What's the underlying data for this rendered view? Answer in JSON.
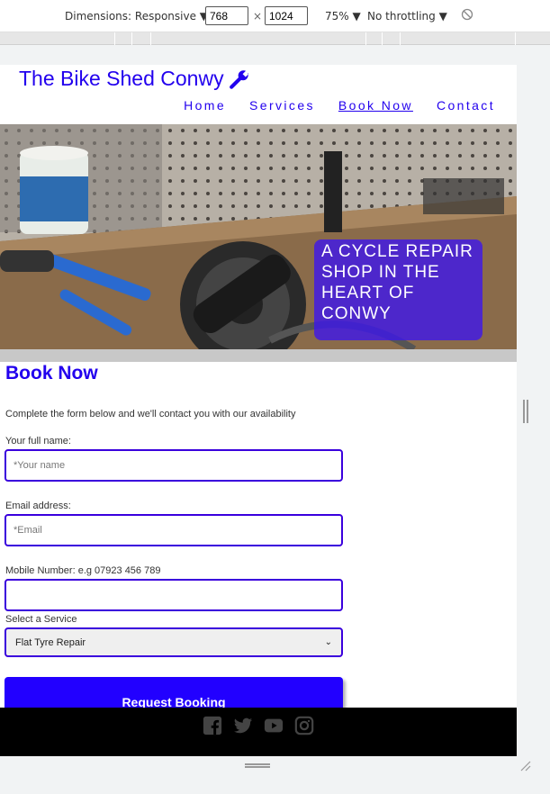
{
  "devtools": {
    "dimensions_label": "Dimensions: Responsive ▼",
    "width": "768",
    "times": "×",
    "height": "1024",
    "zoom": "75% ▼",
    "throttling": "No throttling ▼",
    "rotate_icon": "rotate-disabled-icon"
  },
  "site": {
    "logo_text": "The Bike Shed Conwy",
    "logo_icon": "wrench-icon",
    "nav": [
      {
        "label": "Home"
      },
      {
        "label": "Services"
      },
      {
        "label": "Book Now"
      },
      {
        "label": "Contact"
      }
    ],
    "hero_caption": "A CYCLE REPAIR SHOP IN THE HEART OF CONWY"
  },
  "booking": {
    "title": "Book Now",
    "intro": "Complete the form below and we'll contact you with our availability",
    "name_label": "Your full name:",
    "name_placeholder": "*Your name",
    "email_label": "Email address:",
    "email_placeholder": "*Email",
    "mobile_label": "Mobile Number: e.g 07923 456 789",
    "mobile_value": "",
    "service_label": "Select a Service",
    "service_selected": "Flat Tyre Repair",
    "submit_label": "Request Booking"
  },
  "footer": {
    "icons": [
      "facebook-icon",
      "twitter-icon",
      "youtube-icon",
      "instagram-icon"
    ]
  },
  "colors": {
    "brand": "#2200ee",
    "button": "#2200ff",
    "caption_bg": "#3c14f0",
    "footer_bg": "#000000"
  }
}
